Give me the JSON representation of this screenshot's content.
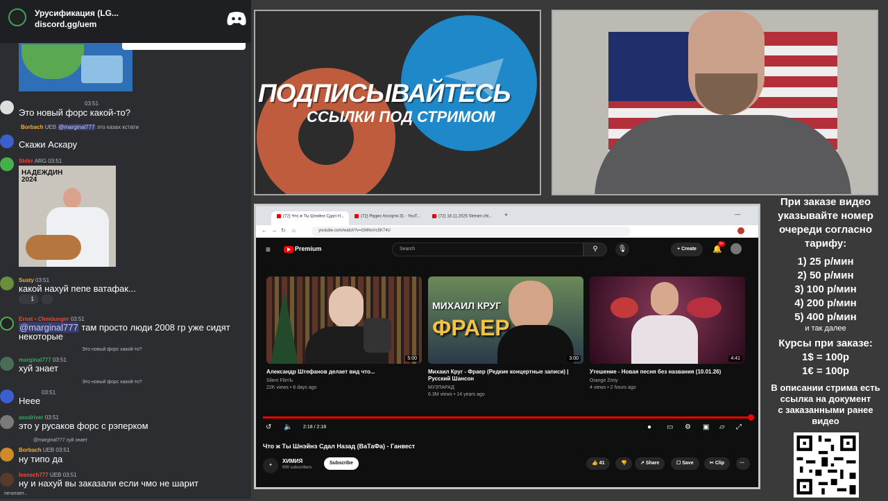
{
  "discord": {
    "server_name": "Урусификация (LG...",
    "invite": "discord.gg/uem"
  },
  "chat": {
    "messages": [
      {
        "user": "",
        "time": "03:51",
        "text": "Это новый форс какой-то?"
      },
      {
        "user": "Borbach",
        "badge": "UEB",
        "mention": "@marginal777",
        "reply_text": "это казах кстати"
      },
      {
        "user": "",
        "text": "Скажи Аскару"
      },
      {
        "user": "Shlirr",
        "badge": "ARG",
        "time": "03:51"
      },
      {
        "user": "Susty",
        "time": "03:51",
        "text": "какой нахуй пепе ватафак...",
        "reaction_count": "1"
      },
      {
        "user": "Ernst • Chmüunger",
        "time": "03:51",
        "mention": "@marginal777",
        "text": "там просто люди 2008 гр уже сидят",
        "text2": "некоторые"
      },
      {
        "reply_text": "Это новый форс какой-то?",
        "user": "marginal777",
        "time": "03:51",
        "text": "хуй знает"
      },
      {
        "reply_text": "Это новый форс какой-то?",
        "time": "03:51",
        "text": "Нееe"
      },
      {
        "user": "assdriver",
        "time": "03:51",
        "text": "это у русаков форс с рэперком"
      },
      {
        "reply_text": "@marginal777 хуй знает",
        "user": "Borbach",
        "badge": "UEB",
        "time": "03:51",
        "text": "ну типо да"
      },
      {
        "user": "Ieeeech777",
        "badge": "UEB",
        "time": "03:51",
        "text": "ну и нахуй вы заказали если чмо не шарит"
      }
    ],
    "image_caption": "НАДЕЖДИН 2024",
    "typing": "печатает..."
  },
  "banner": {
    "line1": "ПОДПИСЫВАЙТЕСЬ",
    "line2": "ССЫЛКИ ПОД СТРИМОМ"
  },
  "browser": {
    "tabs": [
      "(72) Что ж Ты Шнэйнэ Сдал Н...",
      "(72) Радио Ассорти 31 - YouT...",
      "(72) 18.11.2025 Stream chi..."
    ],
    "url": "youtube.com/watch?v=GMNsVc5K74U"
  },
  "youtube": {
    "logo": "Premium",
    "search_placeholder": "Search",
    "create": "Create",
    "notifications": "9+",
    "cards": [
      {
        "title": "Александр Штефанов делает вид что...",
        "channel": "Silent FilmЪ",
        "stats": "22K views • 8 days ago",
        "duration": "5:00"
      },
      {
        "title": "Михаил Круг - Фраер (Редкие концертные записи) | Русский Шансон",
        "channel": "МУЗПАРАД",
        "stats": "6.3M views • 14 years ago",
        "duration": "3:00",
        "thumb_text1": "МИХАИЛ КРУГ",
        "thumb_text2": "ФРАЕР"
      },
      {
        "title": "Утешение - Новая песня без названия (10.01.26)",
        "channel": "Orange Zmiy",
        "stats": "4 views • 2 hours ago",
        "duration": "4:41"
      }
    ],
    "time": "2:18 / 2:18",
    "progress": 1.0,
    "video_title": "Что ж Ты Шнэйнэ Сдал Назад (ВаТаФа) - Ганвест",
    "channel": "ХИМИЯ",
    "subscribers": "990 subscribers",
    "subscribe": "Subscribe",
    "likes": "41",
    "share": "Share",
    "save": "Save",
    "clip": "Clip"
  },
  "info": {
    "lines": [
      "При заказе видео",
      "указывайте номер",
      "очереди согласно",
      "тарифу:"
    ],
    "tariffs": [
      "1) 25 р/мин",
      "2) 50 р/мин",
      "3) 100 р/мин",
      "4) 200 р/мин",
      "5) 400 р/мин"
    ],
    "etc": "и так далее",
    "rates_title": "Курсы при заказе:",
    "rates": [
      "1$ = 100р",
      "1€ = 100р"
    ],
    "desc": [
      "В описании стрима есть",
      "ссылка на документ",
      "с заказанными ранее",
      "видео"
    ]
  }
}
